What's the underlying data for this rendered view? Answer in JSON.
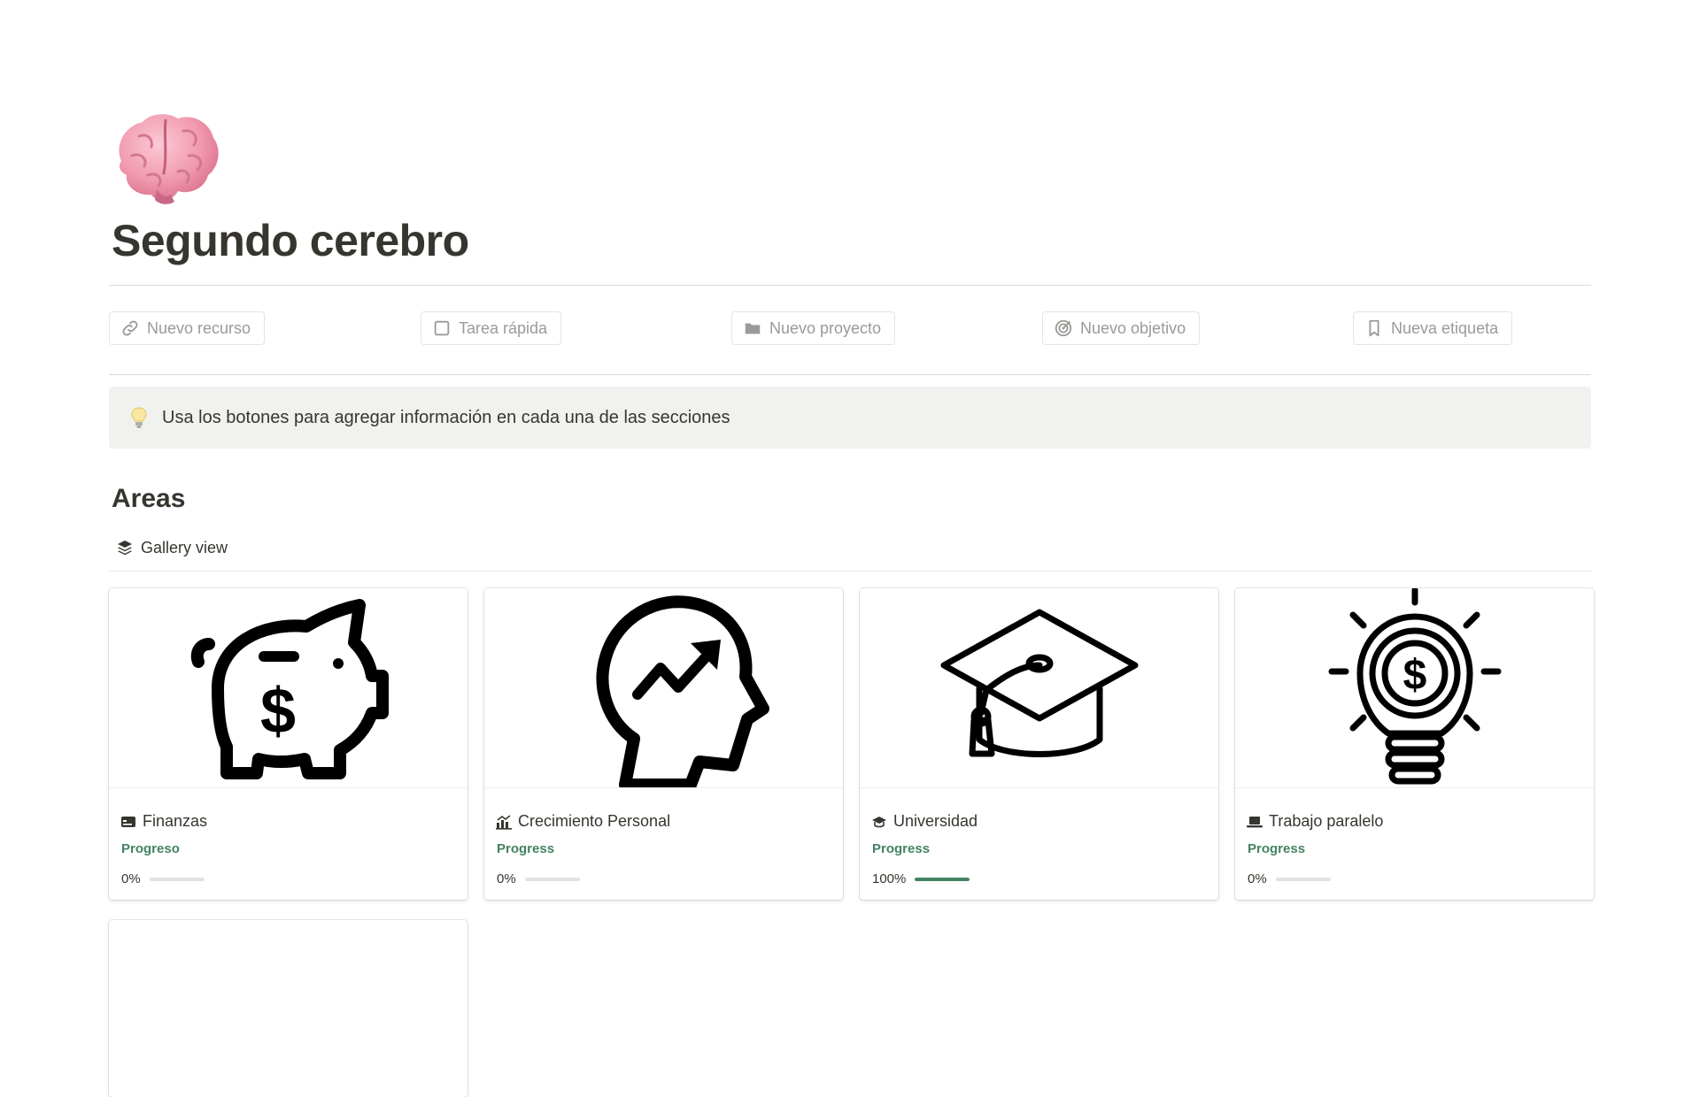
{
  "page": {
    "icon": "brain-emoji",
    "title": "Segundo cerebro"
  },
  "quick_buttons": [
    {
      "label": "Nuevo recurso",
      "icon": "link-icon"
    },
    {
      "label": "Tarea rápida",
      "icon": "checkbox-icon"
    },
    {
      "label": "Nuevo proyecto",
      "icon": "folder-icon"
    },
    {
      "label": "Nuevo objetivo",
      "icon": "target-icon"
    },
    {
      "label": "Nueva etiqueta",
      "icon": "bookmark-icon"
    }
  ],
  "callout": {
    "icon": "lightbulb-icon",
    "text": "Usa los botones para agregar información en cada una de las secciones"
  },
  "areas": {
    "heading": "Areas",
    "view_label": "Gallery view",
    "view_icon": "layers-icon",
    "cards": [
      {
        "name": "Finanzas",
        "icon": "card-icon",
        "cover": "piggy-bank",
        "property_label": "Progreso",
        "progress_text": "0%",
        "progress": 0
      },
      {
        "name": "Crecimiento Personal",
        "icon": "growth-chart-icon",
        "cover": "head-growth",
        "property_label": "Progress",
        "progress_text": "0%",
        "progress": 0
      },
      {
        "name": "Universidad",
        "icon": "graduation-cap-icon",
        "cover": "graduation-cap",
        "property_label": "Progress",
        "progress_text": "100%",
        "progress": 1
      },
      {
        "name": "Trabajo paralelo",
        "icon": "laptop-icon",
        "cover": "money-lightbulb",
        "property_label": "Progress",
        "progress_text": "0%",
        "progress": 0
      }
    ]
  },
  "colors": {
    "text": "#37352f",
    "muted": "#9b9a97",
    "property_green": "#448361",
    "callout_bg": "#f1f1ef",
    "progress_track": "#e3e2e0",
    "brain_pink": "#f1a0b4"
  }
}
